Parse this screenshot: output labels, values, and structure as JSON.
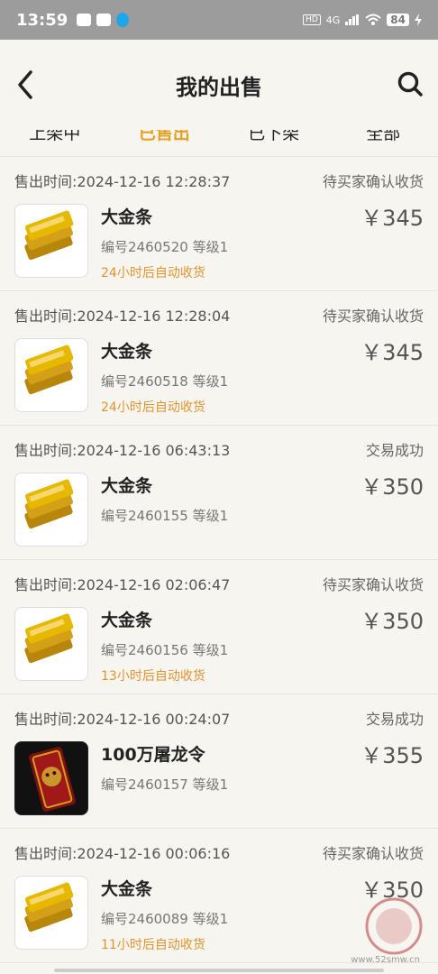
{
  "status_bar": {
    "time": "13:59",
    "hd": "HD",
    "network": "4G",
    "battery": "84"
  },
  "header": {
    "title": "我的出售"
  },
  "tabs": [
    {
      "label": "上架中",
      "active": false
    },
    {
      "label": "已售出",
      "active": true
    },
    {
      "label": "已下架",
      "active": false
    },
    {
      "label": "全部",
      "active": false
    }
  ],
  "orders": [
    {
      "time": "售出时间:2024-12-16 12:28:37",
      "status": "待买家确认收货",
      "name": "大金条",
      "meta": "编号2460520 等级1",
      "auto": "24小时后自动收货",
      "price": "￥345",
      "icon": "gold-bar-icon"
    },
    {
      "time": "售出时间:2024-12-16 12:28:04",
      "status": "待买家确认收货",
      "name": "大金条",
      "meta": "编号2460518 等级1",
      "auto": "24小时后自动收货",
      "price": "￥345",
      "icon": "gold-bar-icon"
    },
    {
      "time": "售出时间:2024-12-16 06:43:13",
      "status": "交易成功",
      "name": "大金条",
      "meta": "编号2460155 等级1",
      "auto": "",
      "price": "￥350",
      "icon": "gold-bar-icon"
    },
    {
      "time": "售出时间:2024-12-16 02:06:47",
      "status": "待买家确认收货",
      "name": "大金条",
      "meta": "编号2460156 等级1",
      "auto": "13小时后自动收货",
      "price": "￥350",
      "icon": "gold-bar-icon"
    },
    {
      "time": "售出时间:2024-12-16 00:24:07",
      "status": "交易成功",
      "name": "100万屠龙令",
      "meta": "编号2460157 等级1",
      "auto": "",
      "price": "￥355",
      "icon": "dragon-token-icon"
    },
    {
      "time": "售出时间:2024-12-16 00:06:16",
      "status": "待买家确认收货",
      "name": "大金条",
      "meta": "编号2460089 等级1",
      "auto": "11小时后自动收货",
      "price": "￥350",
      "icon": "gold-bar-icon"
    }
  ],
  "watermark": {
    "url": "www.52smw.cn"
  },
  "colors": {
    "accent": "#e8a020",
    "auto_text": "#e6932c",
    "background": "#f7f5f0"
  }
}
